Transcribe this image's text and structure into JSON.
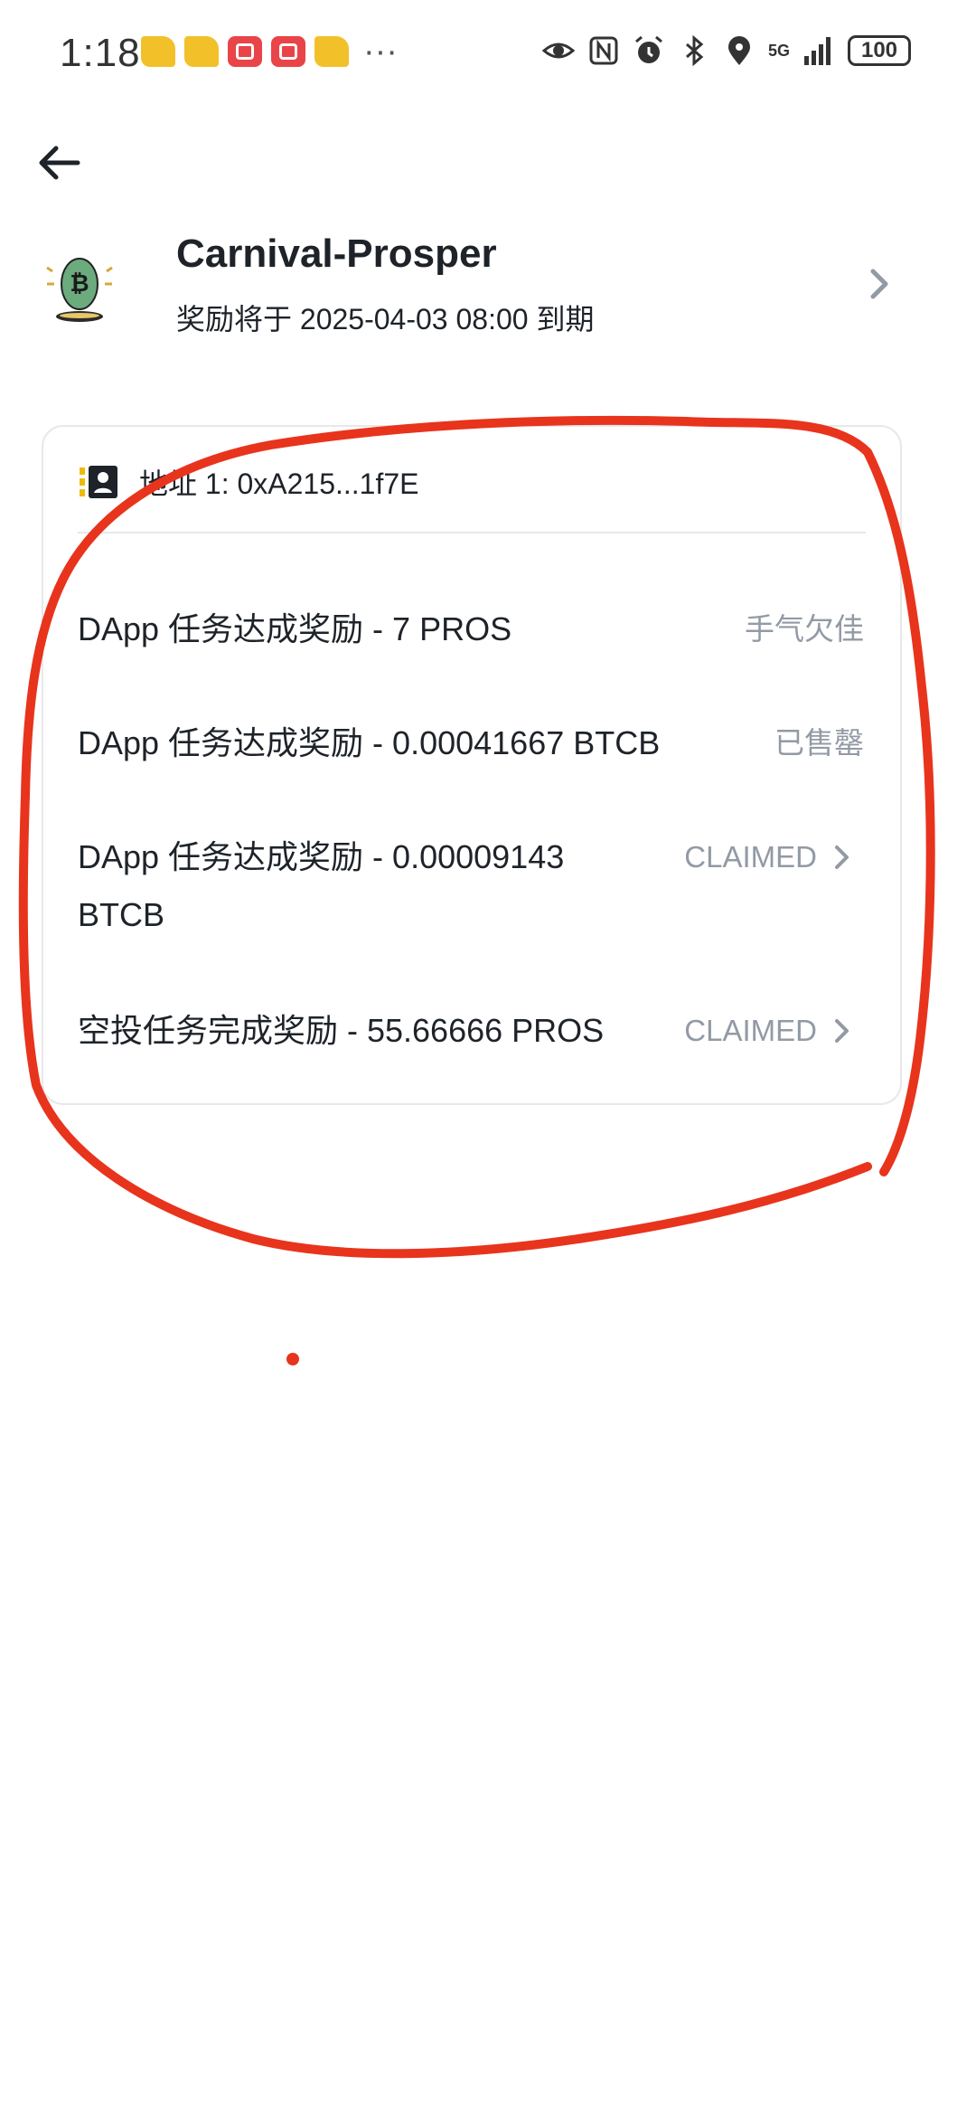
{
  "status_bar": {
    "time": "1:18",
    "more": "···",
    "network": "5G",
    "battery": "100"
  },
  "header": {
    "back_icon": "arrow-left-icon"
  },
  "project": {
    "title": "Carnival-Prosper",
    "subtitle": "奖励将于 2025-04-03 08:00 到期"
  },
  "card": {
    "address": "地址 1: 0xA215...1f7E",
    "rewards": [
      {
        "label": "DApp 任务达成奖励 - 7 PROS",
        "status": "手气欠佳",
        "has_chevron": false
      },
      {
        "label": "DApp 任务达成奖励 - 0.00041667 BTCB",
        "status": "已售罄",
        "has_chevron": false
      },
      {
        "label_line1": "DApp 任务达成奖励 - 0.00009143",
        "label_line2": "BTCB",
        "status": "CLAIMED",
        "has_chevron": true
      },
      {
        "label": "空投任务完成奖励 - 55.66666 PROS",
        "status": "CLAIMED",
        "has_chevron": true
      }
    ]
  },
  "colors": {
    "text_primary": "#1e2329",
    "text_secondary": "#929aa5",
    "border": "#e6e8ea",
    "annotation": "#e8341c",
    "accent_yellow": "#f0b90b"
  }
}
